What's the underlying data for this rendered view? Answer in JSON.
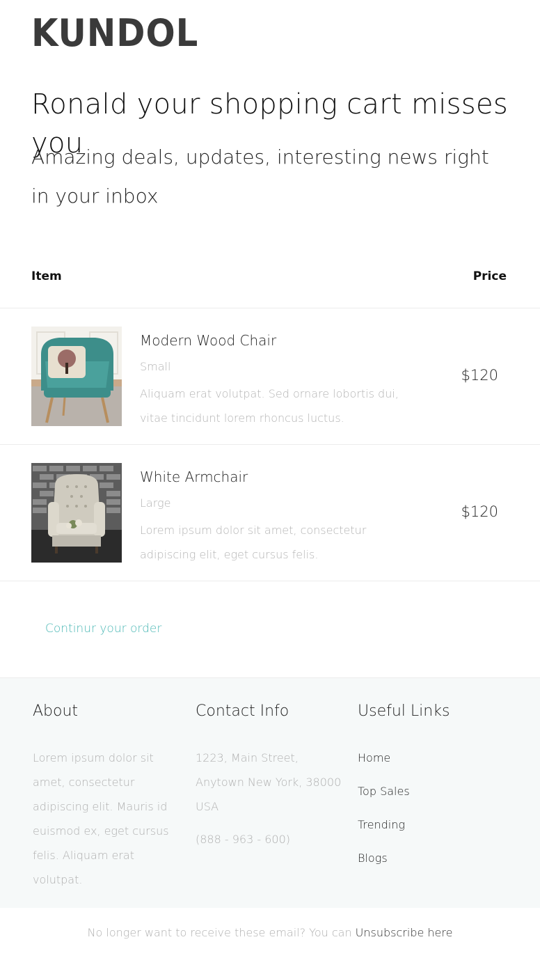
{
  "brand": {
    "logo_text": "KUNDOL"
  },
  "hero": {
    "title": "Ronald your shopping cart misses you",
    "subtitle": "Amazing deals, updates, interesting news right in your inbox"
  },
  "cart": {
    "header_item": "Item",
    "header_price": "Price",
    "items": [
      {
        "name": "Modern Wood Chair",
        "size": "Small",
        "description": "Aliquam erat volutpat. Sed ornare lobortis dui, vitae tincidunt lorem rhoncus luctus.",
        "price": "$120",
        "image_icon": "teal-armchair-photo"
      },
      {
        "name": "White Armchair",
        "size": "Large",
        "description": "Lorem ipsum dolor sit amet, consectetur adipiscing elit, eget cursus felis.",
        "price": "$120",
        "image_icon": "white-tufted-armchair-photo"
      }
    ],
    "continue_label": "Continur your order"
  },
  "footer": {
    "about": {
      "title": "About",
      "text": "Lorem ipsum dolor sit amet, consectetur adipiscing elit. Mauris id euismod ex, eget cursus felis. Aliquam erat volutpat."
    },
    "contact": {
      "title": "Contact Info",
      "address": "1223, Main Street, Anytown New York, 38000 USA",
      "phone": "(888 - 963 - 600)"
    },
    "links": {
      "title": "Useful Links",
      "items": [
        "Home",
        "Top Sales",
        "Trending",
        "Blogs"
      ]
    }
  },
  "unsubscribe": {
    "prefix": "No longer want to receive these email? You can ",
    "link_label": "Unsubscribe here"
  },
  "colors": {
    "accent": "#4cb8b5",
    "footer_bg": "#f6f9f9",
    "muted_text": "#b0b0b0"
  }
}
